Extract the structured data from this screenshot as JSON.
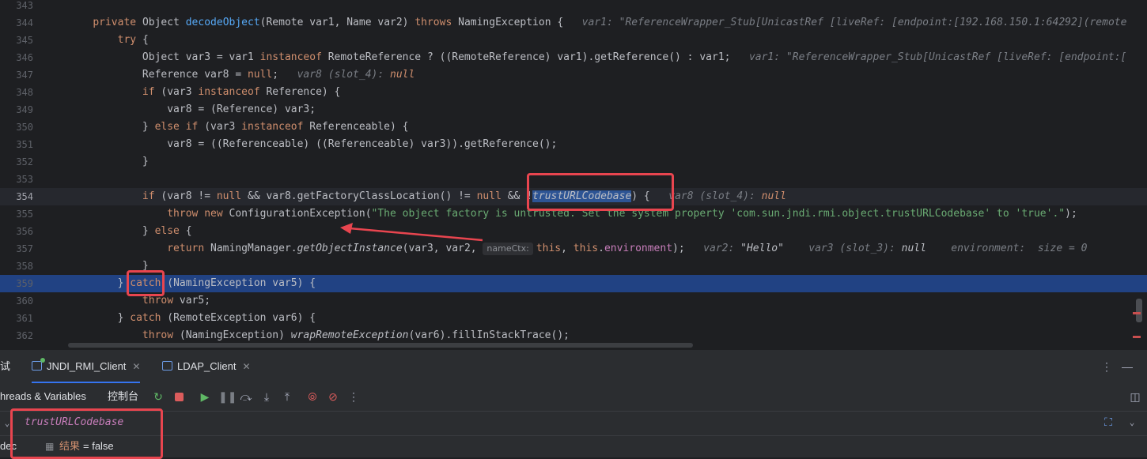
{
  "editor": {
    "lines": [
      {
        "n": "343",
        "segs": []
      },
      {
        "n": "344",
        "segs": [
          {
            "t": "    ",
            "c": "ind"
          },
          {
            "t": "private ",
            "c": "k"
          },
          {
            "t": "Object "
          },
          {
            "t": "decodeObject",
            "c": "f"
          },
          {
            "t": "(Remote var1, Name var2) "
          },
          {
            "t": "throws ",
            "c": "k"
          },
          {
            "t": "NamingException {   "
          },
          {
            "t": "var1: ",
            "c": "hint"
          },
          {
            "t": "\"ReferenceWrapper_Stub[UnicastRef [liveRef: [endpoint:[192.168.150.1:64292](remote",
            "c": "hint"
          }
        ]
      },
      {
        "n": "345",
        "segs": [
          {
            "t": "        ",
            "c": "ind"
          },
          {
            "t": "try ",
            "c": "k"
          },
          {
            "t": "{"
          }
        ]
      },
      {
        "n": "346",
        "segs": [
          {
            "t": "            ",
            "c": "ind"
          },
          {
            "t": "Object var3 = var1 "
          },
          {
            "t": "instanceof ",
            "c": "k"
          },
          {
            "t": "RemoteReference ? ((RemoteReference) var1).getReference() : var1;   "
          },
          {
            "t": "var1: ",
            "c": "hint"
          },
          {
            "t": "\"ReferenceWrapper_Stub[UnicastRef [liveRef: [endpoint:[",
            "c": "hint"
          }
        ]
      },
      {
        "n": "347",
        "segs": [
          {
            "t": "            ",
            "c": "ind"
          },
          {
            "t": "Reference var8 = "
          },
          {
            "t": "null",
            "c": "k"
          },
          {
            "t": ";   "
          },
          {
            "t": "var8 (slot_4): ",
            "c": "hint"
          },
          {
            "t": "null",
            "c": "k it"
          }
        ]
      },
      {
        "n": "348",
        "segs": [
          {
            "t": "            ",
            "c": "ind"
          },
          {
            "t": "if ",
            "c": "k"
          },
          {
            "t": "(var3 "
          },
          {
            "t": "instanceof ",
            "c": "k"
          },
          {
            "t": "Reference) {"
          }
        ]
      },
      {
        "n": "349",
        "segs": [
          {
            "t": "                ",
            "c": "ind"
          },
          {
            "t": "var8 = (Reference) var3;"
          }
        ]
      },
      {
        "n": "350",
        "segs": [
          {
            "t": "            ",
            "c": "ind"
          },
          {
            "t": "} "
          },
          {
            "t": "else if ",
            "c": "k"
          },
          {
            "t": "(var3 "
          },
          {
            "t": "instanceof ",
            "c": "k"
          },
          {
            "t": "Referenceable) {"
          }
        ]
      },
      {
        "n": "351",
        "segs": [
          {
            "t": "                ",
            "c": "ind"
          },
          {
            "t": "var8 = ((Referenceable) ((Referenceable) var3)).getReference();"
          }
        ]
      },
      {
        "n": "352",
        "segs": [
          {
            "t": "            ",
            "c": "ind"
          },
          {
            "t": "}"
          }
        ]
      },
      {
        "n": "353",
        "segs": []
      },
      {
        "n": "354",
        "cur": true,
        "segs": [
          {
            "t": "            ",
            "c": "ind"
          },
          {
            "t": "if ",
            "c": "k"
          },
          {
            "t": "(var8 != "
          },
          {
            "t": "null ",
            "c": "k"
          },
          {
            "t": "&& var8.getFactoryClassLocation() != "
          },
          {
            "t": "null ",
            "c": "k"
          },
          {
            "t": "&& !"
          },
          {
            "t": "trustURLCodebase",
            "c": "fld it sel"
          },
          {
            "t": ") {   "
          },
          {
            "t": "var8 (slot_4): ",
            "c": "hint"
          },
          {
            "t": "null",
            "c": "k it"
          }
        ]
      },
      {
        "n": "355",
        "segs": [
          {
            "t": "                ",
            "c": "ind"
          },
          {
            "t": "throw new ",
            "c": "k"
          },
          {
            "t": "ConfigurationException("
          },
          {
            "t": "\"The object factory is untrusted. Set the system property 'com.sun.jndi.rmi.object.trustURLCodebase' to 'true'.\"",
            "c": "s"
          },
          {
            "t": ");"
          }
        ]
      },
      {
        "n": "356",
        "segs": [
          {
            "t": "            ",
            "c": "ind"
          },
          {
            "t": "} "
          },
          {
            "t": "else ",
            "c": "k"
          },
          {
            "t": "{"
          }
        ]
      },
      {
        "n": "357",
        "segs": [
          {
            "t": "                ",
            "c": "ind"
          },
          {
            "t": "return ",
            "c": "k"
          },
          {
            "t": "NamingManager."
          },
          {
            "t": "getObjectInstance",
            "c": "it"
          },
          {
            "t": "(var3, var2, "
          },
          {
            "t": "nameCtx:",
            "c": "chip"
          },
          {
            "t": "this",
            "c": "k"
          },
          {
            "t": ", "
          },
          {
            "t": "this",
            "c": "k"
          },
          {
            "t": "."
          },
          {
            "t": "environment",
            "c": "fld"
          },
          {
            "t": ");   "
          },
          {
            "t": "var2: ",
            "c": "hint"
          },
          {
            "t": "\"Hello\"",
            "c": "hv"
          },
          {
            "t": "    var3 (slot_3): ",
            "c": "hint"
          },
          {
            "t": "null",
            "c": "hv"
          },
          {
            "t": "    environment:  size = 0",
            "c": "hint"
          }
        ]
      },
      {
        "n": "358",
        "segs": [
          {
            "t": "            ",
            "c": "ind"
          },
          {
            "t": "}"
          }
        ]
      },
      {
        "n": "359",
        "exec": true,
        "segs": [
          {
            "t": "        ",
            "c": "ind"
          },
          {
            "t": "} "
          },
          {
            "t": "catch ",
            "c": "k"
          },
          {
            "t": "(NamingException var5) {"
          }
        ]
      },
      {
        "n": "360",
        "segs": [
          {
            "t": "            ",
            "c": "ind"
          },
          {
            "t": "throw ",
            "c": "k"
          },
          {
            "t": "var5;"
          }
        ]
      },
      {
        "n": "361",
        "segs": [
          {
            "t": "        ",
            "c": "ind"
          },
          {
            "t": "} "
          },
          {
            "t": "catch ",
            "c": "k"
          },
          {
            "t": "(RemoteException var6) {"
          }
        ]
      },
      {
        "n": "362",
        "segs": [
          {
            "t": "            ",
            "c": "ind"
          },
          {
            "t": "throw ",
            "c": "k"
          },
          {
            "t": "(NamingException) "
          },
          {
            "t": "wrapRemoteException",
            "c": "it"
          },
          {
            "t": "(var6).fillInStackTrace();"
          }
        ]
      }
    ]
  },
  "debug": {
    "panel_title_fragment": "试",
    "tabs": [
      {
        "label": "JNDI_RMI_Client",
        "active": true
      },
      {
        "label": "LDAP_Client",
        "active": false
      }
    ],
    "toolbar": {
      "threads_label": "hreads & Variables",
      "console_label": "控制台"
    },
    "watch_expression": "trustURLCodebase",
    "result_label": "结果",
    "result_value": "= false",
    "left_fragment": "dec"
  },
  "colors": {
    "highlight_box": "#e8454f",
    "execution_line": "#214283",
    "accent": "#3574f0"
  }
}
